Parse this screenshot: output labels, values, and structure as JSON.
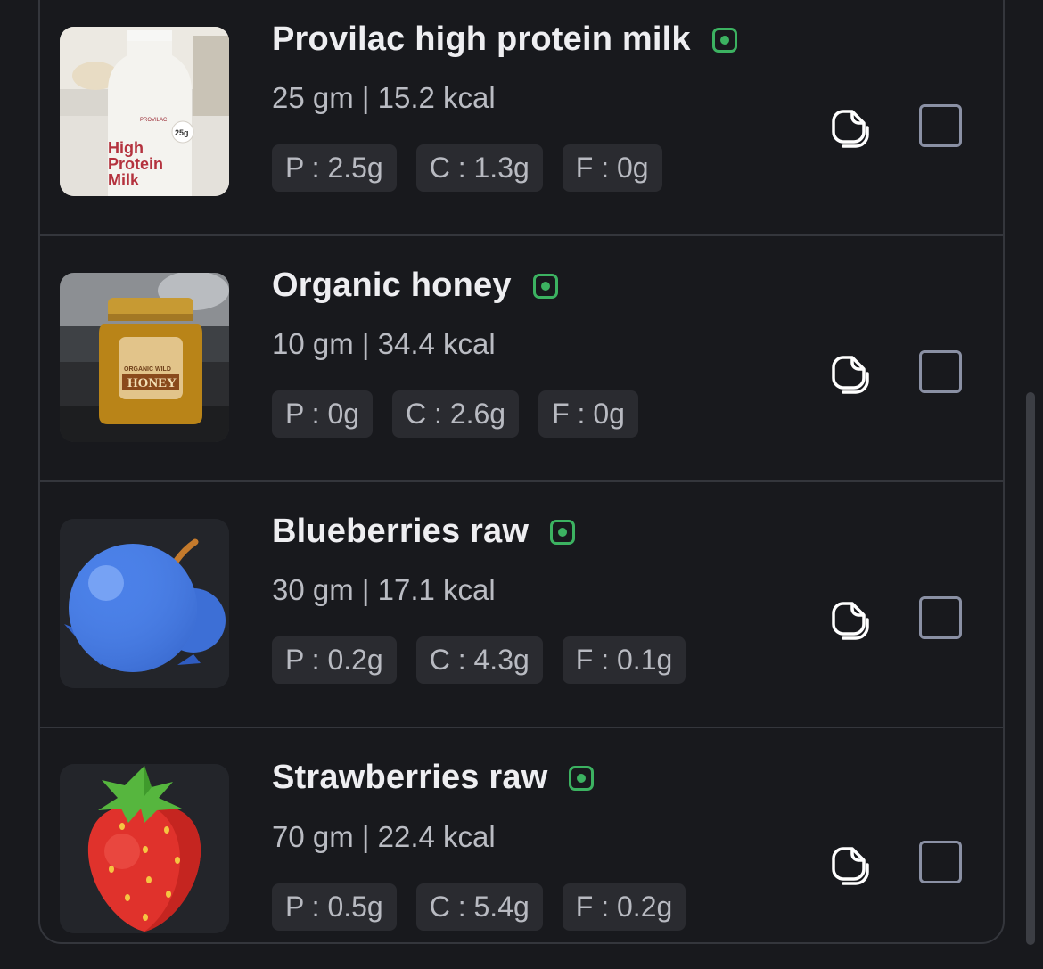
{
  "colors": {
    "background": "#18191d",
    "veg_indicator": "#3cb261",
    "pill_background": "#2a2b30",
    "checkbox_border": "#8a90a4"
  },
  "items": [
    {
      "name": "Provilac high protein milk",
      "summary": "25 gm | 15.2 kcal",
      "protein": "P : 2.5g",
      "carbs": "C : 1.3g",
      "fat": "F : 0g",
      "image_icon": "milk-bottle-photo",
      "image_text": {
        "brand": "PROVILAC",
        "line1": "High",
        "line2": "Protein",
        "line3": "Milk",
        "badge": "25g"
      },
      "veg": true,
      "checked": false
    },
    {
      "name": "Organic honey",
      "summary": "10 gm | 34.4 kcal",
      "protein": "P : 0g",
      "carbs": "C : 2.6g",
      "fat": "F : 0g",
      "image_icon": "honey-jar-photo",
      "image_text": {
        "label": "HONEY",
        "sublabel": "ORGANIC WILD"
      },
      "veg": true,
      "checked": false
    },
    {
      "name": "Blueberries raw",
      "summary": "30 gm | 17.1 kcal",
      "protein": "P : 0.2g",
      "carbs": "C : 4.3g",
      "fat": "F : 0.1g",
      "image_icon": "blueberry-icon",
      "veg": true,
      "checked": false
    },
    {
      "name": "Strawberries raw",
      "summary": "70 gm | 22.4 kcal",
      "protein": "P : 0.5g",
      "carbs": "C : 5.4g",
      "fat": "F : 0.2g",
      "image_icon": "strawberry-icon",
      "veg": true,
      "checked": false
    }
  ]
}
